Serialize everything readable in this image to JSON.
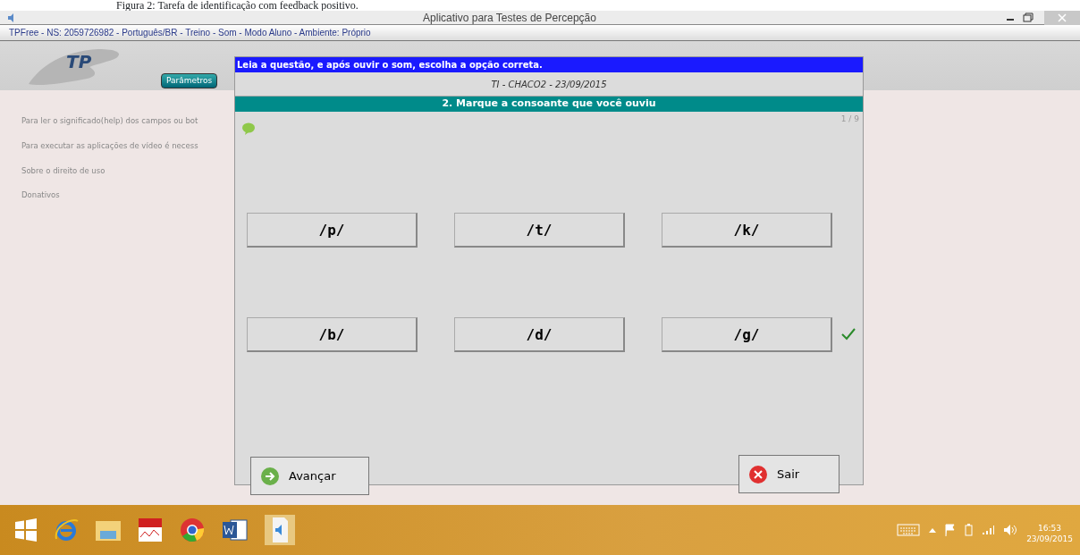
{
  "caption": "Figura 2: Tarefa de identificação com feedback positivo.",
  "window": {
    "title": "Aplicativo para Testes de Percepção"
  },
  "status_line": "TPFree - NS: 2059726982 - Português/BR - Treino - Som - Modo Aluno - Ambiente: Próprio",
  "logo": "TP",
  "parameters_button": "Parâmetros",
  "sidebar": {
    "items": [
      "Para ler o significado(help) dos campos ou bot",
      "Para executar as aplicações de vídeo é necess",
      "Sobre o direito de uso",
      "Donativos"
    ]
  },
  "dialog": {
    "instruction": "Leia a questão, e após ouvir o som, escolha a opção correta.",
    "subtitle": "TI - CHACO2 - 23/09/2015",
    "question": "2. Marque a consoante que você ouviu",
    "counter": "1 / 9",
    "options": [
      {
        "label": "/p/",
        "selected": false
      },
      {
        "label": "/t/",
        "selected": false
      },
      {
        "label": "/k/",
        "selected": false
      },
      {
        "label": "/b/",
        "selected": false
      },
      {
        "label": "/d/",
        "selected": false
      },
      {
        "label": "/g/",
        "selected": true
      }
    ],
    "next_button": "Avançar",
    "exit_button": "Sair"
  },
  "taskbar": {
    "time": "16:53",
    "date": "23/09/2015"
  }
}
